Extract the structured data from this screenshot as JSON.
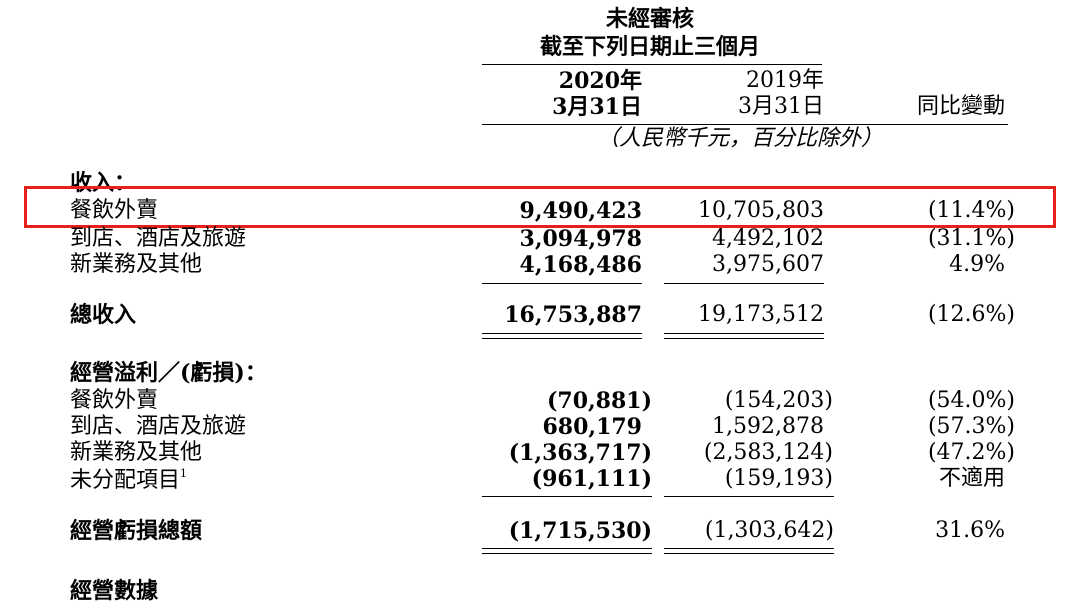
{
  "header": {
    "title_line1": "未經審核",
    "title_line2": "截至下列日期止三個月",
    "col_2020_year": "2020年",
    "col_2020_date": "3月31日",
    "col_2019_year": "2019年",
    "col_2019_date": "3月31日",
    "col_yoy": "同比變動",
    "unit_note": "（人民幣千元，百分比除外）"
  },
  "revenue": {
    "heading": "收入：",
    "rows": [
      {
        "label": "餐飲外賣",
        "v2020": "9,490,423",
        "v2019": "10,705,803",
        "yoy": "(11.4%)"
      },
      {
        "label": "到店、酒店及旅遊",
        "v2020": "3,094,978",
        "v2019": "4,492,102",
        "yoy": "(31.1%)"
      },
      {
        "label": "新業務及其他",
        "v2020": "4,168,486",
        "v2019": "3,975,607",
        "yoy": "4.9%"
      }
    ],
    "total": {
      "label": "總收入",
      "v2020": "16,753,887",
      "v2019": "19,173,512",
      "yoy": "(12.6%)"
    }
  },
  "operating": {
    "heading": "經營溢利／(虧損)：",
    "rows": [
      {
        "label": "餐飲外賣",
        "v2020": "(70,881)",
        "v2019": "(154,203)",
        "yoy": "(54.0%)"
      },
      {
        "label": "到店、酒店及旅遊",
        "v2020": "680,179",
        "v2019": "1,592,878",
        "yoy": "(57.3%)"
      },
      {
        "label": "新業務及其他",
        "v2020": "(1,363,717)",
        "v2019": "(2,583,124)",
        "yoy": "(47.2%)"
      },
      {
        "label": "未分配項目",
        "footnote": "1",
        "v2020": "(961,111)",
        "v2019": "(159,193)",
        "yoy": "不適用"
      }
    ],
    "total": {
      "label": "經營虧損總額",
      "v2020": "(1,715,530)",
      "v2019": "(1,303,642)",
      "yoy": "31.6%"
    }
  },
  "next_section": {
    "heading": "經營數據"
  },
  "highlight_color": "#e8201b"
}
